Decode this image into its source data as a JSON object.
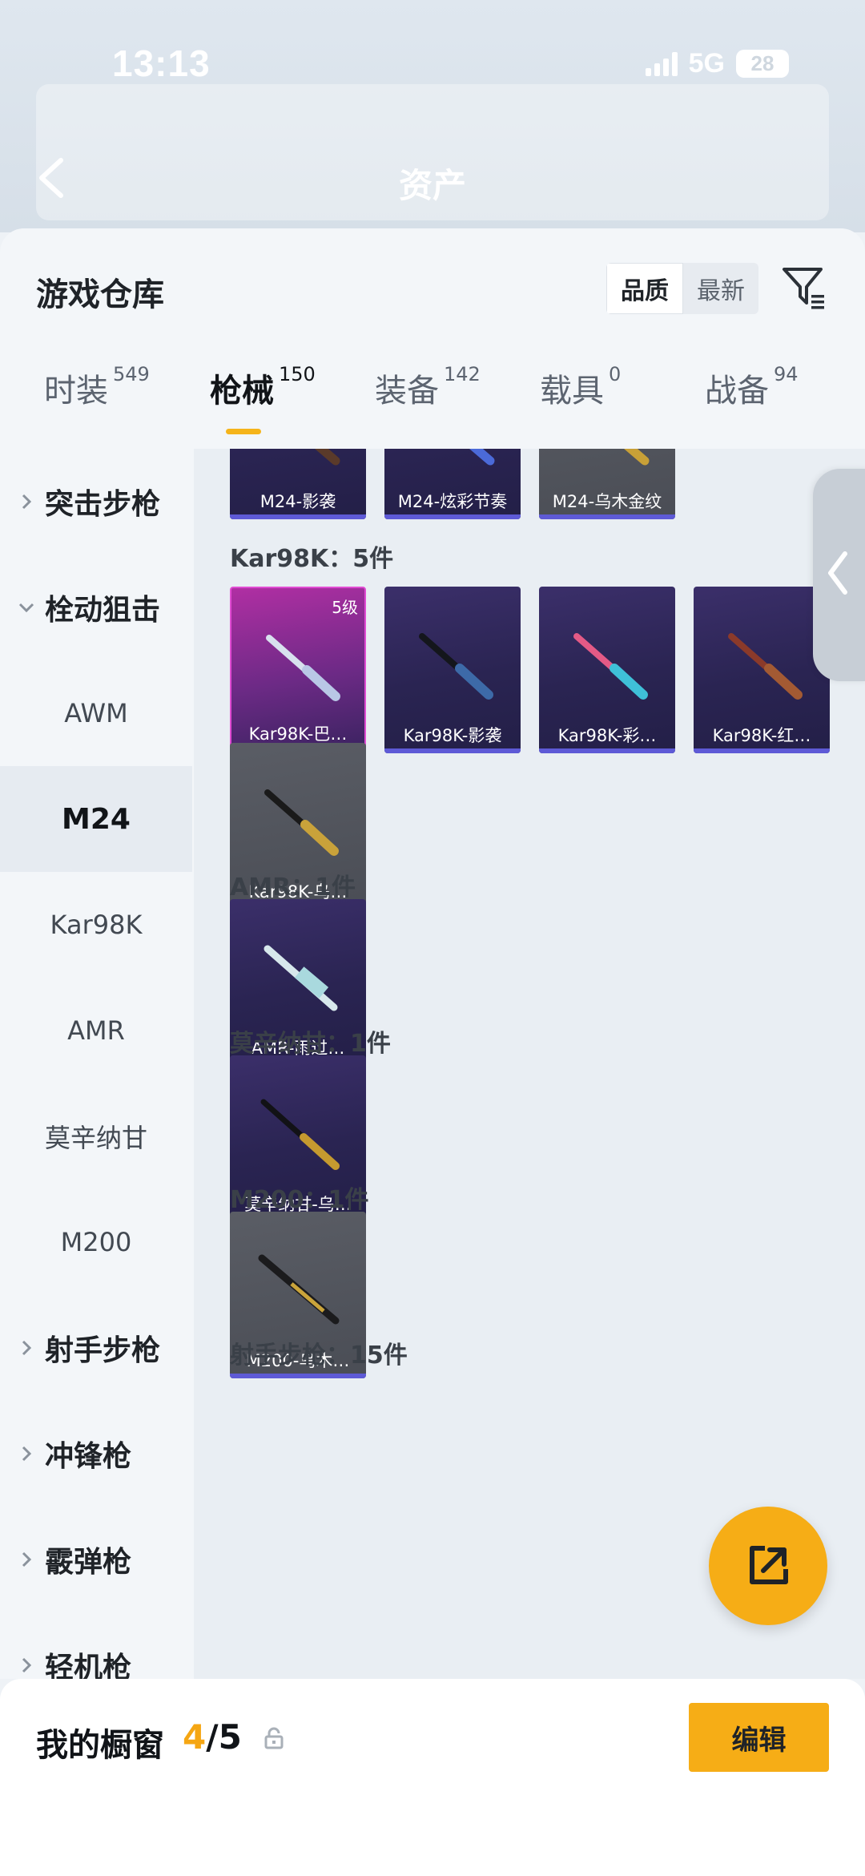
{
  "status_bar": {
    "time": "13:13",
    "network": "5G",
    "battery": "28"
  },
  "header": {
    "title": "资产"
  },
  "sheet": {
    "title": "游戏仓库",
    "sort_options": [
      {
        "label": "品质",
        "active": true
      },
      {
        "label": "最新",
        "active": false
      }
    ]
  },
  "tabs": [
    {
      "label": "时装",
      "count": "549",
      "active": false
    },
    {
      "label": "枪械",
      "count": "150",
      "active": true
    },
    {
      "label": "装备",
      "count": "142",
      "active": false
    },
    {
      "label": "载具",
      "count": "0",
      "active": false
    },
    {
      "label": "战备",
      "count": "94",
      "active": false
    }
  ],
  "sidebar": {
    "items": [
      {
        "label": "突击步枪",
        "type": "group",
        "expanded": false
      },
      {
        "label": "栓动狙击",
        "type": "group",
        "expanded": true
      },
      {
        "label": "AWM",
        "type": "sub"
      },
      {
        "label": "M24",
        "type": "sub",
        "selected": true
      },
      {
        "label": "Kar98K",
        "type": "sub"
      },
      {
        "label": "AMR",
        "type": "sub"
      },
      {
        "label": "莫辛纳甘",
        "type": "sub"
      },
      {
        "label": "M200",
        "type": "sub"
      },
      {
        "label": "射手步枪",
        "type": "group",
        "expanded": false
      },
      {
        "label": "冲锋枪",
        "type": "group",
        "expanded": false
      },
      {
        "label": "霰弹枪",
        "type": "group",
        "expanded": false
      },
      {
        "label": "轻机枪",
        "type": "group",
        "expanded": false
      }
    ]
  },
  "content": {
    "m24_cards": [
      {
        "name": "M24-影袭"
      },
      {
        "name": "M24-炫彩节奏"
      },
      {
        "name": "M24-乌木金纹"
      }
    ],
    "kar98k": {
      "label": "Kar98K：5件",
      "cards": [
        {
          "name": "Kar98K-巴…",
          "level": "5级",
          "rarity": "legend"
        },
        {
          "name": "Kar98K-影袭"
        },
        {
          "name": "Kar98K-彩…"
        },
        {
          "name": "Kar98K-红…"
        },
        {
          "name": "Kar98K-乌…",
          "rarity": "grey"
        }
      ]
    },
    "amr": {
      "label": "AMR：1件",
      "cards": [
        {
          "name": "AMR-雨过…"
        }
      ]
    },
    "mosin": {
      "label": "莫辛纳甘：1件",
      "cards": [
        {
          "name": "莫辛纳甘-乌…"
        }
      ]
    },
    "m200": {
      "label": "M200：1件",
      "cards": [
        {
          "name": "M200-乌木…",
          "rarity": "grey"
        }
      ]
    },
    "marksman": {
      "label": "射手步枪：15件"
    }
  },
  "bottom_bar": {
    "label": "我的橱窗",
    "current": "4",
    "total": "/5",
    "edit_label": "编辑"
  },
  "colors": {
    "accent": "#f6ad16",
    "legend": "#e04bd2",
    "epic": "#5e5ad6"
  }
}
